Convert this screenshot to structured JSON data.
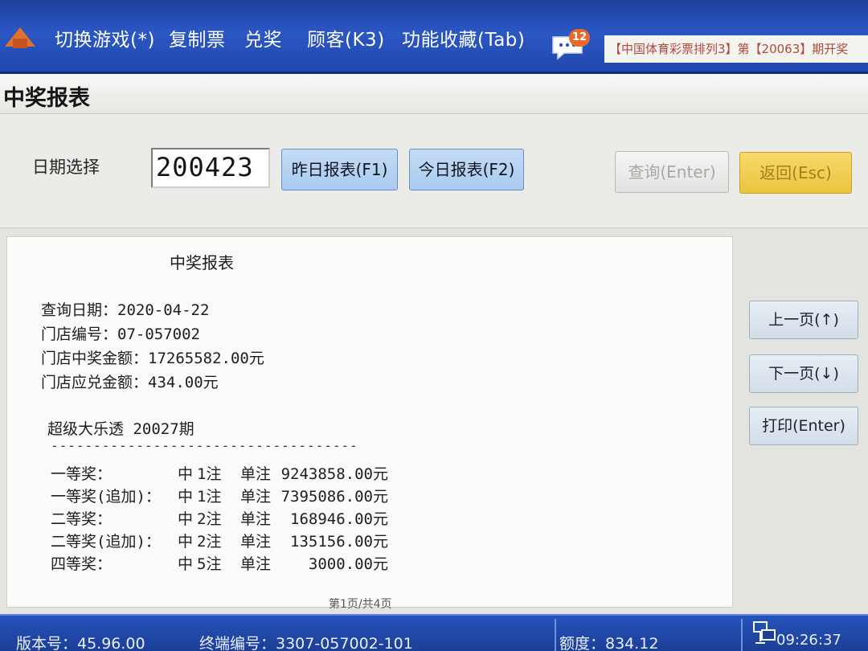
{
  "menu": {
    "items": [
      "切换游戏(*)",
      "复制票",
      "兑奖",
      "顾客(K3)",
      "功能收藏(Tab)"
    ],
    "badge_count": "12",
    "ticker": "【中国体育彩票排列3】第【20063】期开奖"
  },
  "page": {
    "title": "中奖报表"
  },
  "controls": {
    "date_label": "日期选择",
    "date_value": "200423",
    "yesterday_btn": "昨日报表(F1)",
    "today_btn": "今日报表(F2)",
    "query_btn": "查询(Enter)",
    "back_btn": "返回(Esc)"
  },
  "report": {
    "title": "中奖报表",
    "query_date": "查询日期：2020-04-22",
    "store_id": "门店编号：07-057002",
    "store_prize_total": "门店中奖金额：17265582.00元",
    "store_payable": "门店应兑金额：434.00元",
    "game": "超级大乐透 20027期",
    "separator": "------------------------------------",
    "prizes": [
      {
        "name": "一等奖：",
        "zhong": "中",
        "count": "1注",
        "unit": "单注",
        "amount": "9243858.00元"
      },
      {
        "name": "一等奖(追加)：",
        "zhong": "中",
        "count": "1注",
        "unit": "单注",
        "amount": "7395086.00元"
      },
      {
        "name": "二等奖：",
        "zhong": "中",
        "count": "2注",
        "unit": "单注",
        "amount": "168946.00元"
      },
      {
        "name": "二等奖(追加)：",
        "zhong": "中",
        "count": "2注",
        "unit": "单注",
        "amount": "135156.00元"
      },
      {
        "name": "四等奖：",
        "zhong": "中",
        "count": "5注",
        "unit": "单注",
        "amount": "3000.00元"
      }
    ],
    "pager": "第1页/共4页"
  },
  "side": {
    "prev_btn": "上一页(↑)",
    "next_btn": "下一页(↓)",
    "print_btn": "打印(Enter)"
  },
  "status": {
    "version": "版本号：45.96.00",
    "terminal": "终端编号：3307-057002-101",
    "balance": "额度：834.12",
    "time": "09:26:37"
  },
  "colors": {
    "menu_bar": "#2b57c4",
    "button_blue": "#a9caef",
    "button_yellow": "#e9c43e",
    "status_bar": "#2653bd"
  }
}
